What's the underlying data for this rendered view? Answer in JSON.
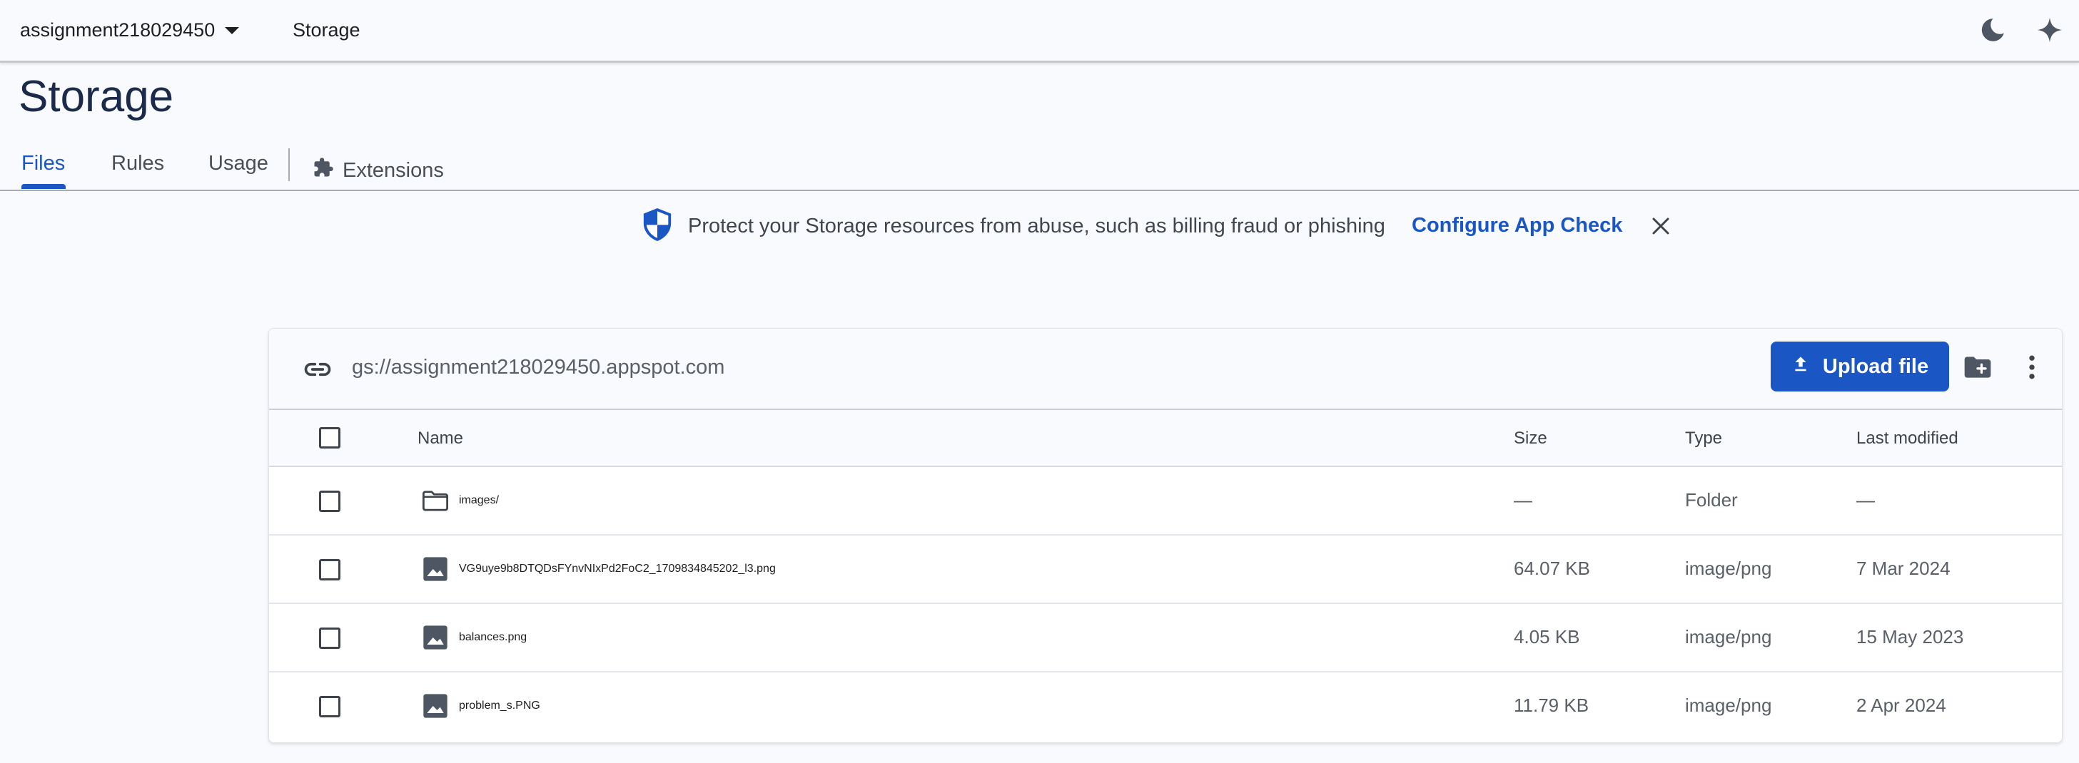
{
  "topbar": {
    "project_name": "assignment218029450",
    "breadcrumb": "Storage",
    "icons": [
      "dark-mode-moon-icon",
      "gemini-sparkle-icon"
    ]
  },
  "page": {
    "title": "Storage",
    "tabs": [
      {
        "label": "Files",
        "active": true
      },
      {
        "label": "Rules",
        "active": false
      },
      {
        "label": "Usage",
        "active": false
      },
      {
        "label": "Extensions",
        "active": false,
        "icon": "puzzle-icon"
      }
    ]
  },
  "banner": {
    "icon": "shield-icon",
    "text": "Protect your Storage resources from abuse, such as billing fraud or phishing",
    "link": "Configure App Check"
  },
  "files": {
    "bucket_path": "gs://assignment218029450.appspot.com",
    "upload_label": "Upload file",
    "columns": {
      "name": "Name",
      "size": "Size",
      "type": "Type",
      "modified": "Last modified"
    },
    "rows": [
      {
        "icon": "folder-icon",
        "name": "images/",
        "size": "—",
        "type": "Folder",
        "modified": "—"
      },
      {
        "icon": "image-icon",
        "name": "VG9uye9b8DTQDsFYnvNIxPd2FoC2_1709834845202_l3.png",
        "size": "64.07 KB",
        "type": "image/png",
        "modified": "7 Mar 2024"
      },
      {
        "icon": "image-icon",
        "name": "balances.png",
        "size": "4.05 KB",
        "type": "image/png",
        "modified": "15 May 2023"
      },
      {
        "icon": "image-icon",
        "name": "problem_s.PNG",
        "size": "11.79 KB",
        "type": "image/png",
        "modified": "2 Apr 2024"
      }
    ]
  },
  "colors": {
    "accent": "#1a56c4",
    "background": "#f8fafd",
    "title": "#1b2a4a"
  }
}
